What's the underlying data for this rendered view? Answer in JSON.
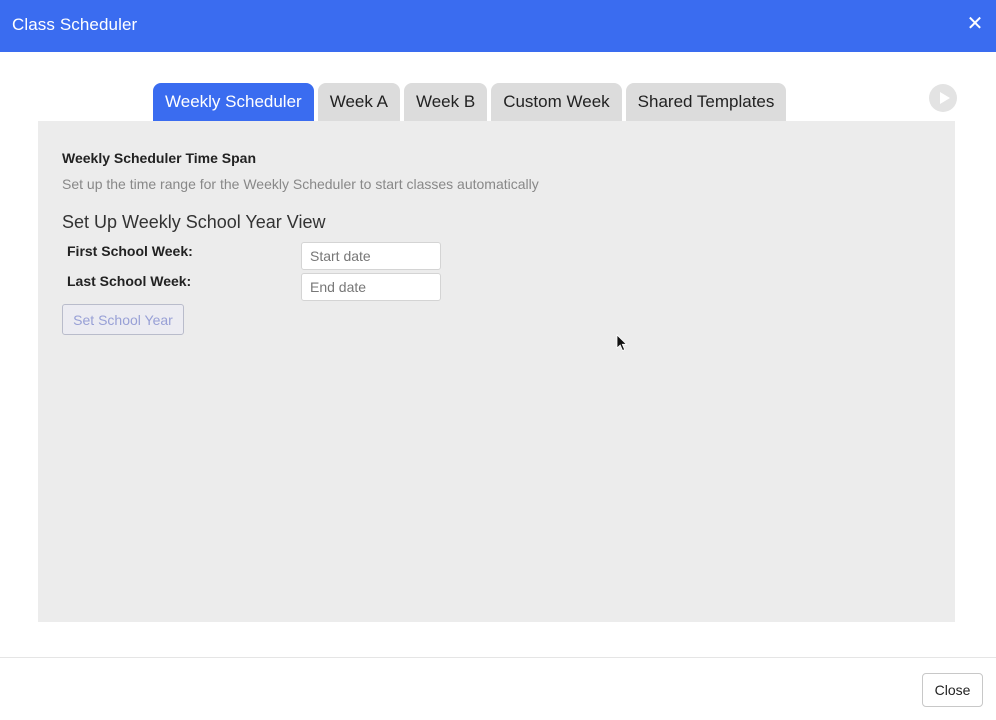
{
  "window": {
    "title": "Class Scheduler",
    "close_symbol": "✕",
    "accent_color": "#3a6cf0"
  },
  "tabs": [
    {
      "label": "Weekly Scheduler",
      "active": true
    },
    {
      "label": "Week A",
      "active": false
    },
    {
      "label": "Week B",
      "active": false
    },
    {
      "label": "Custom Week",
      "active": false
    },
    {
      "label": "Shared Templates",
      "active": false
    }
  ],
  "toolbar": {
    "play_icon": "play-circle-icon"
  },
  "panel": {
    "heading": "Weekly Scheduler Time Span",
    "description": "Set up the time range for the Weekly Scheduler to start classes automatically",
    "subheading": "Set Up Weekly School Year View",
    "first_week": {
      "label": "First School Week:",
      "value": "",
      "placeholder": "Start date"
    },
    "last_week": {
      "label": "Last School Week:",
      "value": "",
      "placeholder": "End date"
    },
    "set_button_label": "Set School Year"
  },
  "footer": {
    "close_label": "Close"
  }
}
